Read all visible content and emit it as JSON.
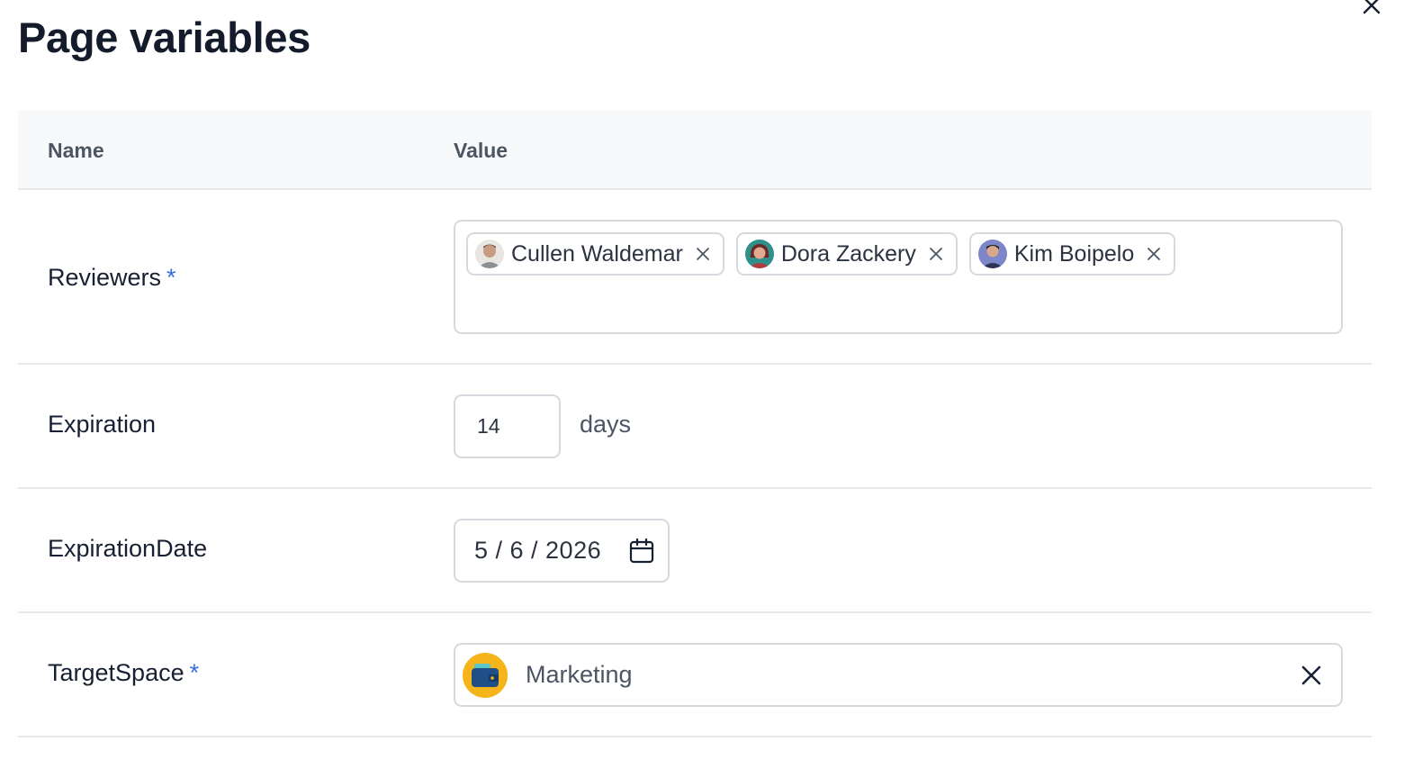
{
  "dialog": {
    "title": "Page variables"
  },
  "table": {
    "columns": {
      "name": "Name",
      "value": "Value"
    },
    "rows": {
      "reviewers": {
        "label": "Reviewers",
        "required_mark": "*",
        "chips": [
          {
            "label": "Cullen Waldemar",
            "avatar": "person-avatar"
          },
          {
            "label": "Dora Zackery",
            "avatar": "person-avatar"
          },
          {
            "label": "Kim Boipelo",
            "avatar": "person-avatar"
          }
        ]
      },
      "expiration": {
        "label": "Expiration",
        "value": "14",
        "unit": "days"
      },
      "expiration_date": {
        "label": "ExpirationDate",
        "value": "5 / 6 / 2026"
      },
      "target_space": {
        "label": "TargetSpace",
        "required_mark": "*",
        "value": "Marketing",
        "icon": "wallet-icon"
      }
    }
  },
  "colors": {
    "required": "#3b6fd9",
    "space_icon_bg": "#f4b41a",
    "border": "#d6d9de",
    "header_bg": "#f8f9fb"
  }
}
